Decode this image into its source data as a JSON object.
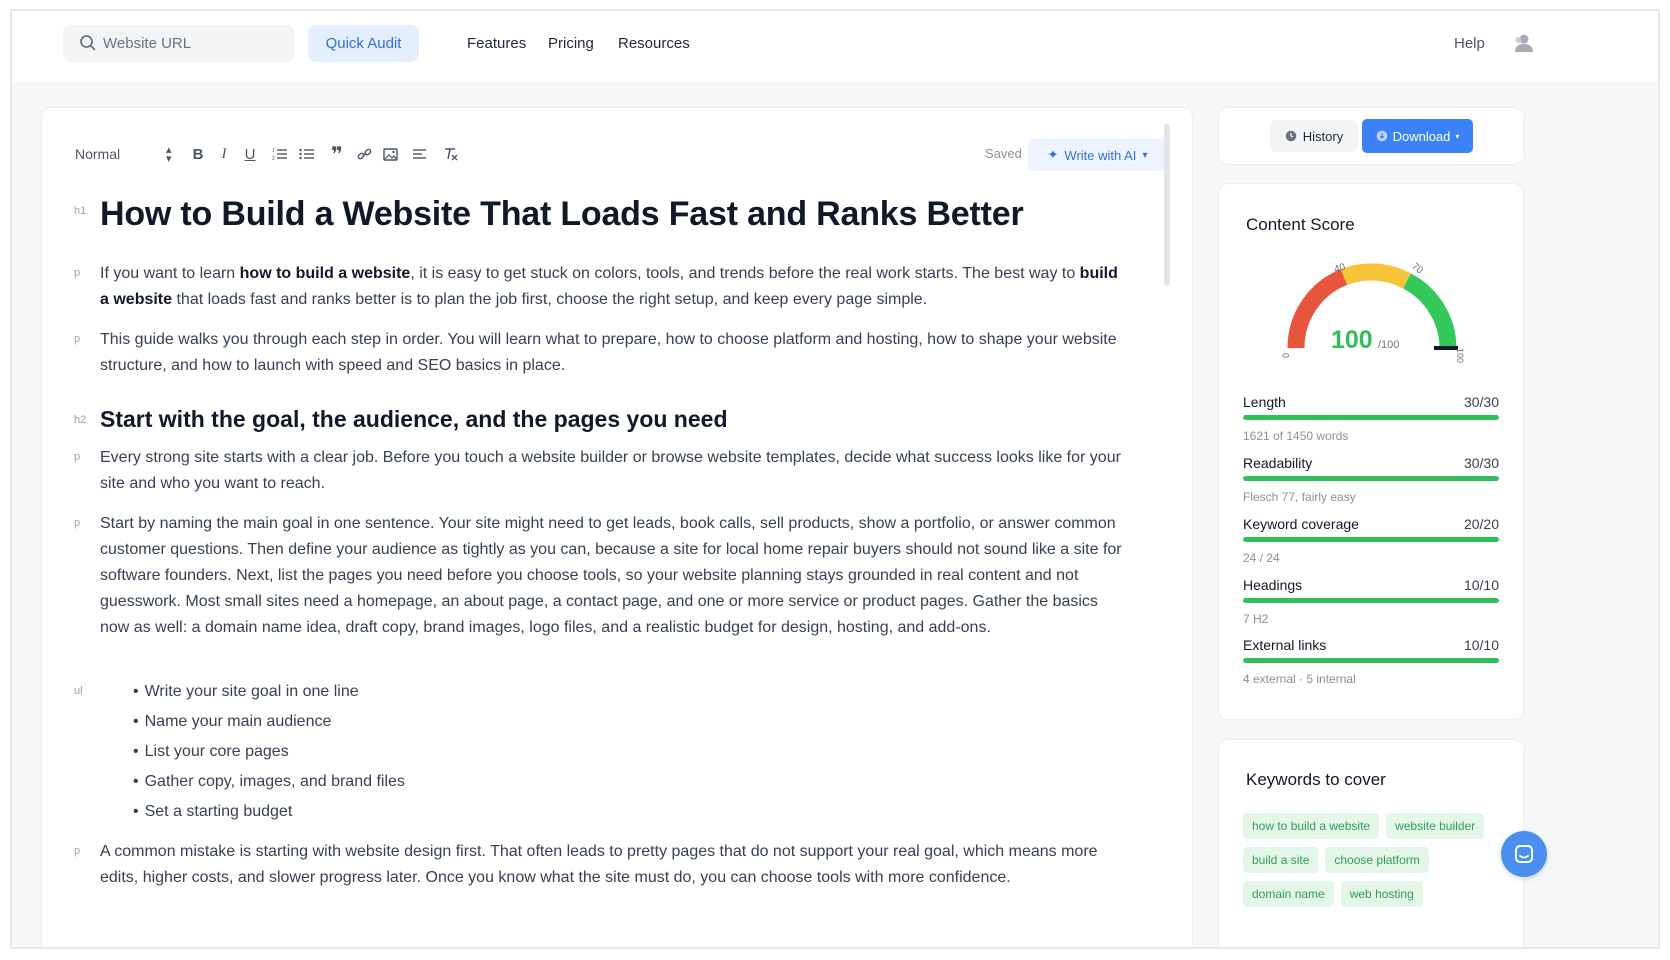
{
  "nav": {
    "search_placeholder": "Website URL",
    "quick_audit": "Quick Audit",
    "links": [
      "Features",
      "Pricing",
      "Resources"
    ],
    "help": "Help"
  },
  "toolbar": {
    "style": "Normal",
    "saved": "Saved",
    "write_ai": "Write with AI"
  },
  "doc": {
    "h1": "How to Build a Website That Loads Fast and Ranks Better",
    "p1_a": "If you want to learn ",
    "p1_b": "how to build a website",
    "p1_c": ", it is easy to get stuck on colors, tools, and trends before the real work starts. The best way to ",
    "p1_d": "build a website",
    "p1_e": " that loads fast and ranks better is to plan the job first, choose the right setup, and keep every page simple.",
    "p2": "This guide walks you through each step in order. You will learn what to prepare, how to choose platform and hosting, how to shape your website structure, and how to launch with speed and SEO basics in place.",
    "h2": "Start with the goal, the audience, and the pages you need",
    "p3": "Every strong site starts with a clear job. Before you touch a website builder or browse website templates, decide what success looks like for your site and who you want to reach.",
    "p4": "Start by naming the main goal in one sentence. Your site might need to get leads, book calls, sell products, show a portfolio, or answer common customer questions. Then define your audience as tightly as you can, because a site for local home repair buyers should not sound like a site for software founders. Next, list the pages you need before you choose tools, so your website planning stays grounded in real content and not guesswork. Most small sites need a homepage, an about page, a contact page, and one or more service or product pages. Gather the basics now as well: a domain name idea, draft copy, brand images, logo files, and a realistic budget for design, hosting, and add-ons.",
    "list": [
      "Write your site goal in one line",
      "Name your main audience",
      "List your core pages",
      "Gather copy, images, and brand files",
      "Set a starting budget"
    ],
    "p5": "A common mistake is starting with website design first. That often leads to pretty pages that do not support your real goal, which means more edits, higher costs, and slower progress later. Once you know what the site must do, you can choose tools with more confidence.",
    "tags": {
      "h1": "h1",
      "p": "p",
      "h2": "h2",
      "ul": "ul"
    }
  },
  "actions": {
    "history": "History",
    "download": "Download"
  },
  "score": {
    "title": "Content Score",
    "value": "100",
    "max": "/100",
    "ticks": [
      "0",
      "40",
      "70",
      "100"
    ],
    "metrics": [
      {
        "label": "Length",
        "value": "30/30",
        "sub": "1621 of 1450 words",
        "fill": 1.0
      },
      {
        "label": "Readability",
        "value": "30/30",
        "sub": "Flesch 77, fairly easy",
        "fill": 1.0
      },
      {
        "label": "Keyword coverage",
        "value": "20/20",
        "sub": "24 / 24",
        "fill": 1.0
      },
      {
        "label": "Headings",
        "value": "10/10",
        "sub": "7 H2",
        "fill": 1.0
      },
      {
        "label": "External links",
        "value": "10/10",
        "sub": "4 external · 5 internal",
        "fill": 1.0
      }
    ]
  },
  "keywords": {
    "title": "Keywords to cover",
    "chips": [
      "how to build a website",
      "website builder",
      "build a site",
      "choose platform",
      "domain name",
      "web hosting"
    ]
  },
  "colors": {
    "accent": "#3b82f6",
    "good": "#2fbf5b",
    "gauge_red": "#e8553f",
    "gauge_yellow": "#f6c436",
    "gauge_green": "#34c759"
  }
}
